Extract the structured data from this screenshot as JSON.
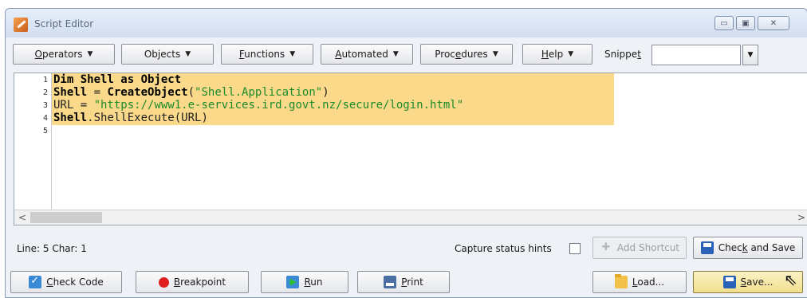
{
  "window": {
    "title": "Script Editor",
    "controls": {
      "minimize": "▭",
      "maximize": "▣",
      "close": "✕"
    }
  },
  "toolbar": {
    "menus": [
      {
        "pre": "",
        "u": "O",
        "post": "perators"
      },
      {
        "pre": "Objects",
        "u": "",
        "post": ""
      },
      {
        "pre": "",
        "u": "F",
        "post": "unctions"
      },
      {
        "pre": "",
        "u": "A",
        "post": "utomated"
      },
      {
        "pre": "Proc",
        "u": "e",
        "post": "dures"
      },
      {
        "pre": "",
        "u": "H",
        "post": "elp"
      }
    ],
    "caret": "▼",
    "snippet_label_pre": "Snippe",
    "snippet_label_u": "t",
    "snippet_value": ""
  },
  "editor": {
    "line_numbers": [
      "1",
      "2",
      "3",
      "4",
      "5"
    ],
    "lines": [
      {
        "kw1": "Dim Shell as Object",
        "txt1": "",
        "str": "",
        "txt2": ""
      },
      {
        "kw1": "Shell",
        "txt1": " = ",
        "kw2": "CreateObject",
        "txt2": "(",
        "str": "\"Shell.Application\"",
        "txt3": ")"
      },
      {
        "txt1": "URL = ",
        "str": "\"https://www1.e-services.ird.govt.nz/secure/login.html\""
      },
      {
        "kw1": "Shell",
        "txt1": ".ShellExecute(URL)"
      },
      {
        "txt1": ""
      }
    ],
    "scroll_left": "<",
    "scroll_right": ">"
  },
  "status": {
    "position": "Line: 5  Char: 1",
    "capture_label": "Capture status hints",
    "capture_checked": false
  },
  "buttons": {
    "add_shortcut": "Add Shortcut",
    "check_and_save_pre": "Chec",
    "check_and_save_u": "k",
    "check_and_save_post": " and Save",
    "check_code_pre": "",
    "check_code_u": "C",
    "check_code_post": "heck Code",
    "breakpoint_u": "B",
    "breakpoint_post": "reakpoint",
    "run_u": "R",
    "run_post": "un",
    "print_u": "P",
    "print_post": "rint",
    "load_u": "L",
    "load_post": "oad...",
    "save_u": "S",
    "save_post": "ave..."
  }
}
